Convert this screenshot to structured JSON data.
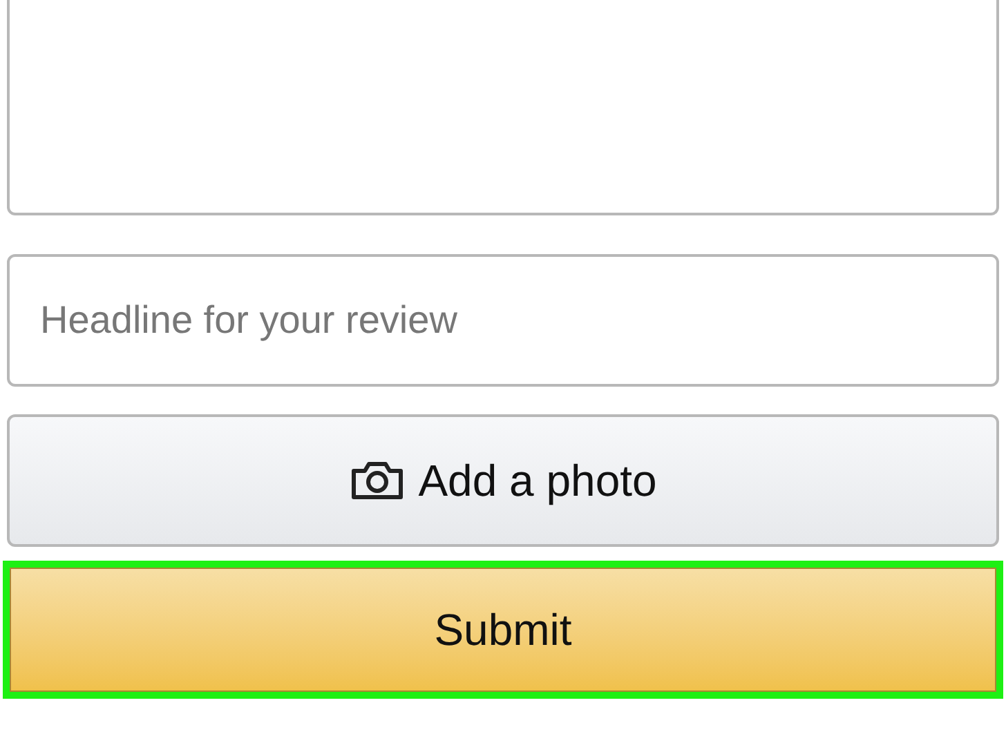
{
  "headline": {
    "placeholder": "Headline for your review"
  },
  "photo_button": {
    "label": "Add a photo"
  },
  "submit_button": {
    "label": "Submit",
    "highlighted": true
  }
}
